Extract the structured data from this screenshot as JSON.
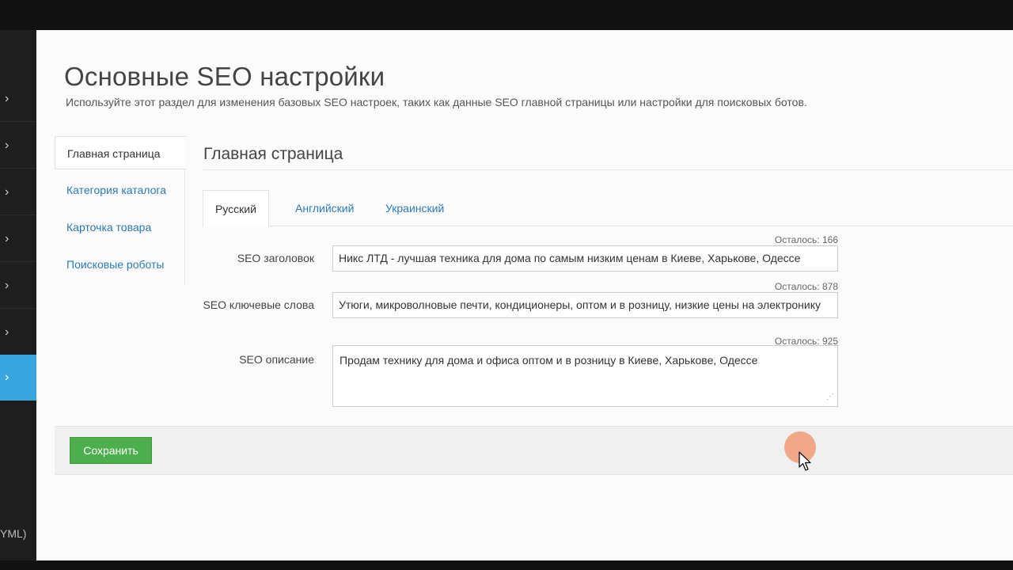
{
  "sidebar": {
    "items": [
      {
        "icon": "chevron-right-icon",
        "glyph": "›",
        "active": false
      },
      {
        "icon": "chevron-right-icon",
        "glyph": "›",
        "active": false
      },
      {
        "icon": "chevron-right-icon",
        "glyph": "›",
        "active": false
      },
      {
        "icon": "chevron-right-icon",
        "glyph": "›",
        "active": false
      },
      {
        "icon": "chevron-right-icon",
        "glyph": "›",
        "active": false
      },
      {
        "icon": "chevron-right-icon",
        "glyph": "›",
        "active": false
      },
      {
        "icon": "chevron-right-icon",
        "glyph": "›",
        "active": true
      }
    ],
    "footer_text": "YML)"
  },
  "page": {
    "title": "Основные SEO настройки",
    "subtitle": "Используйте этот раздел для изменения базовых SEO настроек, таких как данные SEO главной страницы или настройки для поисковых ботов."
  },
  "leftnav": {
    "items": [
      {
        "label": "Главная страница",
        "active": true
      },
      {
        "label": "Категория каталога",
        "active": false
      },
      {
        "label": "Карточка товара",
        "active": false
      },
      {
        "label": "Поисковые роботы",
        "active": false
      }
    ]
  },
  "section": {
    "title": "Главная страница"
  },
  "tabs": [
    {
      "label": "Русский",
      "active": true
    },
    {
      "label": "Английский",
      "active": false
    },
    {
      "label": "Украинский",
      "active": false
    }
  ],
  "form": {
    "seo_title": {
      "label": "SEO заголовок",
      "counter": "Осталось: 166",
      "value": "Никс ЛТД - лучшая техника для дома по самым низким ценам в Киеве, Харькове, Одессе"
    },
    "seo_keywords": {
      "label": "SEO ключевые слова",
      "counter": "Осталось: 878",
      "value": "Утюги, микроволновые печти, кондиционеры, оптом и в розницу, низкие цены на электронику"
    },
    "seo_description": {
      "label": "SEO описание",
      "counter": "Осталось: 925",
      "value": "Продам технику для дома и офиса оптом и в розницу в Киеве, Харькове, Одессе"
    }
  },
  "actions": {
    "save_label": "Сохранить"
  },
  "colors": {
    "accent": "#3aa6e0",
    "link": "#2b7ab8",
    "save": "#4cae4c"
  }
}
